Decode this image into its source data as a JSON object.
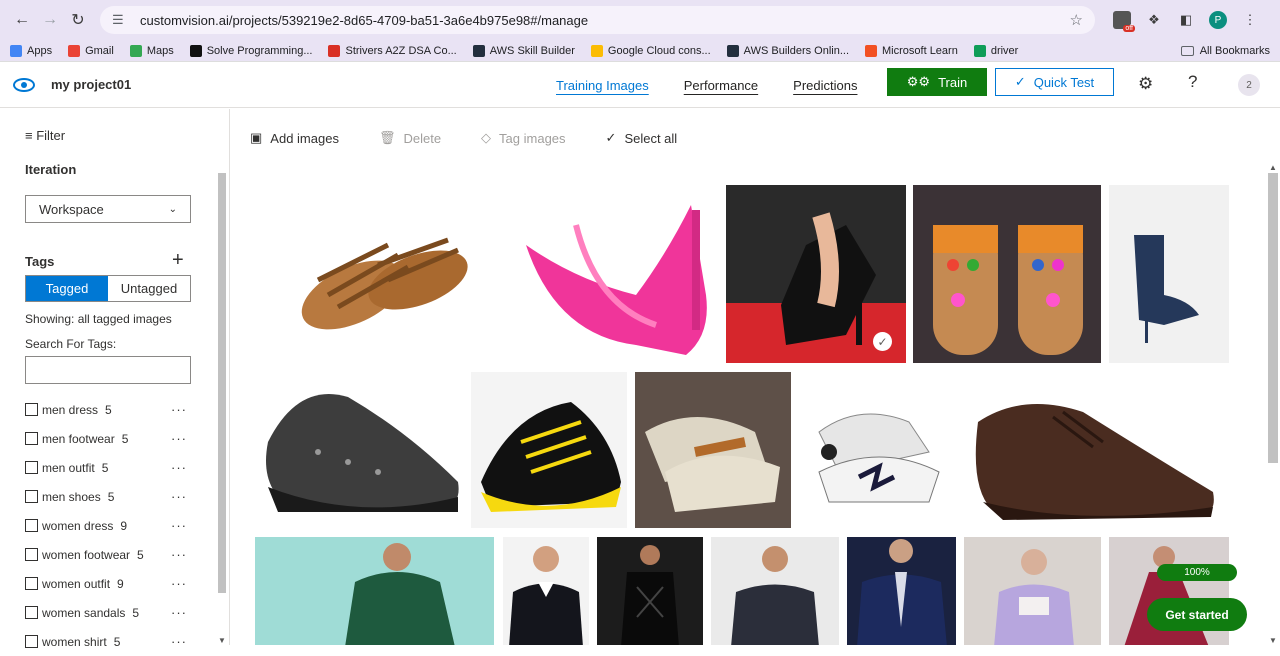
{
  "browser": {
    "url": "customvision.ai/projects/539219e2-8d65-4709-ba51-3a6e4b975e98#/manage",
    "profile_initial": "P",
    "ext_badge": "off",
    "bookmarks": [
      {
        "label": "Apps",
        "color": "#4285f4"
      },
      {
        "label": "Gmail",
        "color": "#ea4335"
      },
      {
        "label": "Maps",
        "color": "#34a853"
      },
      {
        "label": "Solve Programming...",
        "color": "#111111"
      },
      {
        "label": "Strivers A2Z DSA Co...",
        "color": "#d93025"
      },
      {
        "label": "AWS Skill Builder",
        "color": "#232f3e"
      },
      {
        "label": "Google Cloud cons...",
        "color": "#fbbc04"
      },
      {
        "label": "AWS Builders Onlin...",
        "color": "#232f3e"
      },
      {
        "label": "Microsoft Learn",
        "color": "#f25022"
      },
      {
        "label": "driver",
        "color": "#0f9d58"
      }
    ],
    "all_bookmarks": "All Bookmarks"
  },
  "header": {
    "project_name": "my project01",
    "tabs": [
      "Training Images",
      "Performance",
      "Predictions"
    ],
    "train_label": "Train",
    "quick_test_label": "Quick Test",
    "user_initial": "2"
  },
  "sidebar": {
    "filter_label": "Filter",
    "iteration_heading": "Iteration",
    "iteration_value": "Workspace",
    "tags_heading": "Tags",
    "tagged_label": "Tagged",
    "untagged_label": "Untagged",
    "showing_text": "Showing: all tagged images",
    "search_label": "Search For Tags:",
    "tags": [
      {
        "name": "men dress",
        "count": "5"
      },
      {
        "name": "men footwear",
        "count": "5"
      },
      {
        "name": "men outfit",
        "count": "5"
      },
      {
        "name": "men shoes",
        "count": "5"
      },
      {
        "name": "women dress",
        "count": "9"
      },
      {
        "name": "women footwear",
        "count": "5"
      },
      {
        "name": "women outfit",
        "count": "9"
      },
      {
        "name": "women sandals",
        "count": "5"
      },
      {
        "name": "women shirt",
        "count": "5"
      }
    ]
  },
  "toolbar": {
    "add_images": "Add images",
    "delete": "Delete",
    "tag_images": "Tag images",
    "select_all": "Select all"
  },
  "onboarding": {
    "progress": "100%",
    "get_started": "Get started"
  },
  "colors": {
    "accent": "#0078d4",
    "train_green": "#107c10"
  }
}
